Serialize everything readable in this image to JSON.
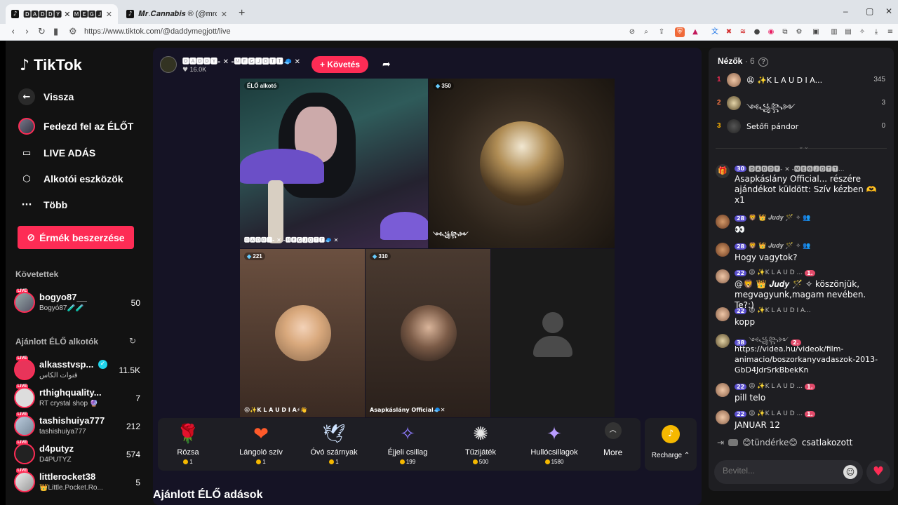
{
  "browser": {
    "tabs": [
      {
        "favicon": "tiktok-icon",
        "title": "🅳🅰🅳🅳🆈 ✕ 🅼🅴🅶🅹🅾🆃🆃 (@d",
        "active": true
      },
      {
        "favicon": "tiktok-icon",
        "title": "𝑴𝒓.𝑪𝒂𝒏𝒏𝒂𝒃𝒊𝒔 ® (@mrcannabis_)",
        "active": false
      }
    ],
    "url": "https://www.tiktok.com/@daddymegjott/live"
  },
  "sidebar": {
    "logo": "TikTok",
    "nav": [
      {
        "icon": "arrow-left-icon",
        "label": "Vissza"
      },
      {
        "icon": "avatar-icon",
        "label": "Fedezd fel az ÉLŐT"
      },
      {
        "icon": "video-camera-icon",
        "label": "LIVE ADÁS"
      },
      {
        "icon": "creator-tools-icon",
        "label": "Alkotói eszközök"
      },
      {
        "icon": "more-dots-icon",
        "label": "Több"
      }
    ],
    "coins_button": "Érmék beszerzése",
    "following_header": "Követettek",
    "following": [
      {
        "name": "bogyo87__",
        "sub": "Bogyó87🧪🧪",
        "count": "50"
      }
    ],
    "recommended_header": "Ajánlott ÉLŐ alkotók",
    "recommended": [
      {
        "name": "alkasstvsp...",
        "sub": "قنوات الكاس",
        "count": "11.5K",
        "verified": true
      },
      {
        "name": "rthighquality...",
        "sub": "RT crystal shop 🔮",
        "count": "7"
      },
      {
        "name": "tashishuiya777",
        "sub": "tashishuiya777",
        "count": "212"
      },
      {
        "name": "d4putyz",
        "sub": "D4PUTYZ",
        "count": "574"
      },
      {
        "name": "littlerocket38",
        "sub": "👑Little.Pocket.Ro...",
        "count": "5"
      }
    ]
  },
  "live": {
    "host_name": "🅳🅰🅳🅳🆈- ✕ -🅼🅴🅶🅹🅾🆃🆃🧢 ✕",
    "host_likes": "16.0K",
    "follow_label": "Követés",
    "tiles": [
      {
        "badge": "ÉLŐ alkotó",
        "caption": "🅳🅰🅳🅳🆈- ✕ -🅼🅴🅶🅹🅾🆃🆃🧢 ✕"
      },
      {
        "badge": "350",
        "caption": "༺꧁꧂༻"
      },
      {
        "badge": "221",
        "caption": "😩✨K L A U D I A⚡👋"
      },
      {
        "badge": "310",
        "caption": "Asapkáslány Official🧢✕"
      },
      {
        "badge": "",
        "caption": ""
      }
    ],
    "gifts": [
      {
        "icon": "rose-icon",
        "glyph": "🌹",
        "name": "Rózsa",
        "price": "1"
      },
      {
        "icon": "flaming-heart-icon",
        "glyph": "❤",
        "name": "Lángoló szív",
        "price": "1"
      },
      {
        "icon": "wings-icon",
        "glyph": "🕊",
        "name": "Óvó szárnyak",
        "price": "1"
      },
      {
        "icon": "night-star-icon",
        "glyph": "✧",
        "name": "Éjjeli csillag",
        "price": "199"
      },
      {
        "icon": "fireworks-icon",
        "glyph": "✺",
        "name": "Tűzijáték",
        "price": "500"
      },
      {
        "icon": "shooting-stars-icon",
        "glyph": "✦",
        "name": "Hullócsillagok",
        "price": "1580"
      }
    ],
    "more_label": "More",
    "recharge_label": "Recharge ⌃",
    "recommended_title": "Ajánlott ÉLŐ adások"
  },
  "viewers": {
    "title": "Nézők",
    "count": "· 6",
    "list": [
      {
        "rank": "1",
        "rank_color": "#fe2c55",
        "name": "😩 ✨K L A U D I A...",
        "score": "345"
      },
      {
        "rank": "2",
        "rank_color": "#ff7a45",
        "name": "༺꧁꧂༻",
        "score": "3"
      },
      {
        "rank": "3",
        "rank_color": "#ffb400",
        "name": "Setőfi pándor",
        "score": "0"
      }
    ]
  },
  "chat": [
    {
      "badge": "30",
      "user": "🅳🅰🅳🅳🆈- ✕ -🅼🅴🅶🅹🅾🆃🆃...",
      "text": "Asapkáslány Official... részére ajándékot küldött: Szív kézben 🫶 x1"
    },
    {
      "badge": "28",
      "user": "🦁 👑 𝑱𝒖𝒅𝒚 🪄 ✧ 👥",
      "text": "👀"
    },
    {
      "badge": "28",
      "user": "🦁 👑 𝑱𝒖𝒅𝒚 🪄 ✧ 👥",
      "text": "Hogy vagytok?"
    },
    {
      "badge": "22",
      "user": "😩 ✨K L A U D ...",
      "lvl": "1.",
      "text": "@🦁 👑 𝑱𝒖𝒅𝒚 🪄 ✧ köszönjük, megvagyunk,magam nevében. Te?:)"
    },
    {
      "badge": "22",
      "user": "😩 ✨K L A U D I A...",
      "text": "kopp"
    },
    {
      "badge": "38",
      "user": "༺꧁꧂༻",
      "lvl": "2.",
      "text": "https://videa.hu/videok/film-animacio/boszorkanyvadaszok-2013-GbD4JdrSrkBbekKn"
    },
    {
      "badge": "22",
      "user": "😩 ✨K L A U D ...",
      "lvl": "1.",
      "text": "pill telo"
    },
    {
      "badge": "22",
      "user": "😩 ✨K L A U D ...",
      "lvl": "1.",
      "text": "JANUAR 12"
    }
  ],
  "joined": {
    "user": "😊tündérke😊",
    "text": "csatlakozott"
  },
  "input_placeholder": "Bevitel...",
  "colors": {
    "accent": "#fe2c55",
    "coin": "#f5b800",
    "badge": "#5a4fcf"
  }
}
